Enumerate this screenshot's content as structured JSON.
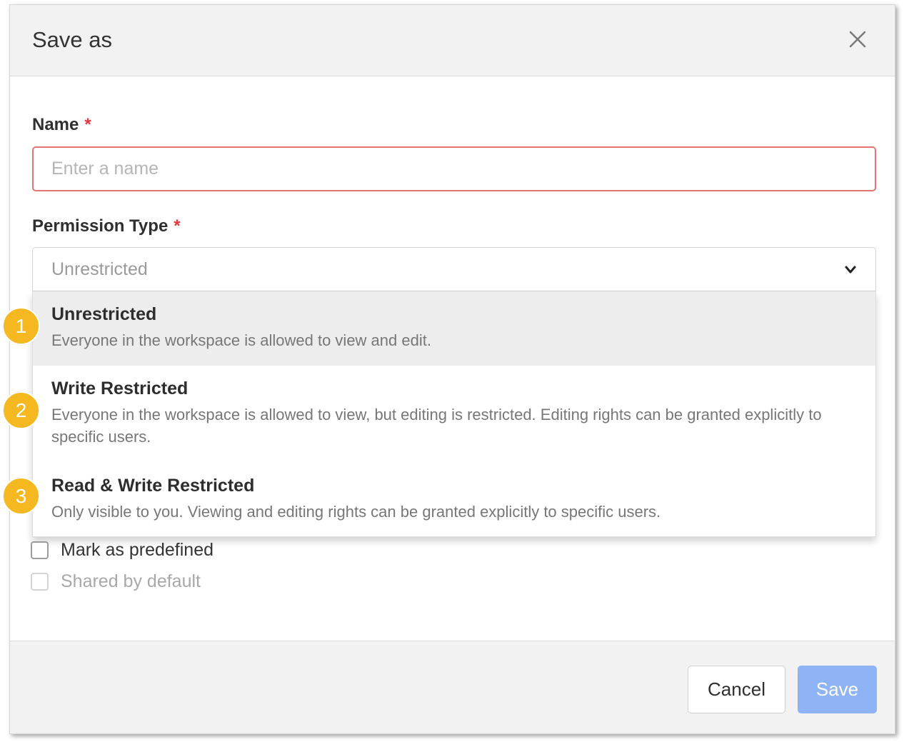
{
  "dialog": {
    "title": "Save as"
  },
  "name_field": {
    "label": "Name",
    "required_mark": "*",
    "value": "",
    "placeholder": "Enter a name"
  },
  "permission_field": {
    "label": "Permission Type",
    "required_mark": "*",
    "selected": "Unrestricted",
    "options": [
      {
        "title": "Unrestricted",
        "description": "Everyone in the workspace is allowed to view and edit.",
        "highlighted": true
      },
      {
        "title": "Write Restricted",
        "description": "Everyone in the workspace is allowed to view, but editing is restricted. Editing rights can be granted explicitly to specific users.",
        "highlighted": false
      },
      {
        "title": "Read & Write Restricted",
        "description": "Only visible to you. Viewing and editing rights can be granted explicitly to specific users.",
        "highlighted": false
      }
    ]
  },
  "checkboxes": [
    {
      "label": "Mark as predefined",
      "checked": false,
      "disabled": false
    },
    {
      "label": "Shared by default",
      "checked": false,
      "disabled": true
    }
  ],
  "footer": {
    "cancel_label": "Cancel",
    "save_label": "Save"
  },
  "annotations": [
    "1",
    "2",
    "3"
  ],
  "colors": {
    "required": "#e5363d",
    "input_error_border": "#e57373",
    "save_button": "#8fb4f5",
    "badge": "#f5b820"
  },
  "icons": {
    "close": "close-icon",
    "dropdown": "chevron-down-icon"
  }
}
